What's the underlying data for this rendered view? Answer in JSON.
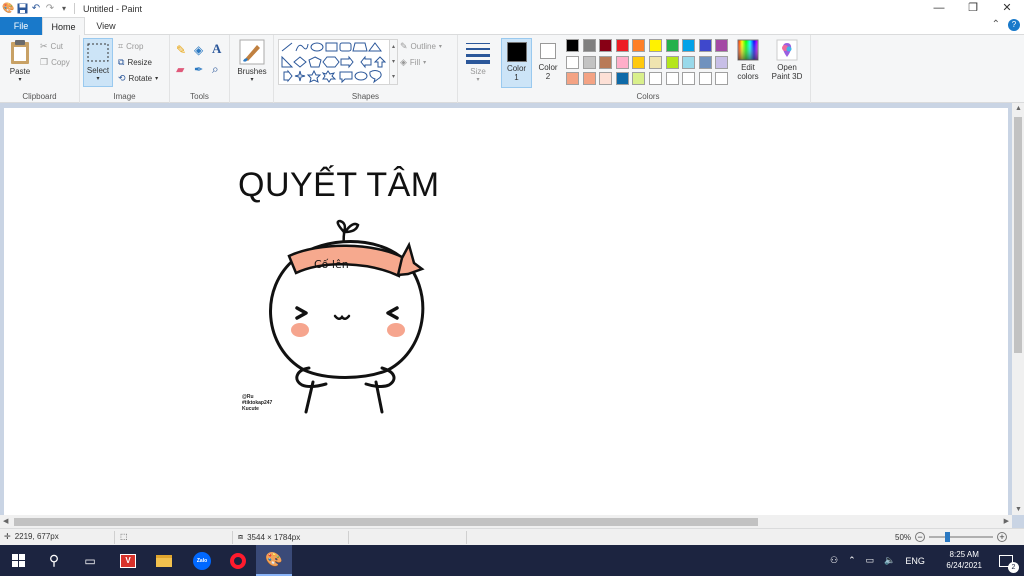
{
  "window": {
    "title": "Untitled - Paint"
  },
  "tabs": {
    "file": "File",
    "home": "Home",
    "view": "View"
  },
  "ribbon": {
    "clipboard": {
      "label": "Clipboard",
      "paste": "Paste",
      "cut": "Cut",
      "copy": "Copy"
    },
    "image": {
      "label": "Image",
      "select": "Select",
      "crop": "Crop",
      "resize": "Resize",
      "rotate": "Rotate"
    },
    "tools": {
      "label": "Tools"
    },
    "brushes": {
      "label": "Brushes"
    },
    "shapes": {
      "label": "Shapes",
      "outline": "Outline",
      "fill": "Fill"
    },
    "size": {
      "label": "Size"
    },
    "color1": {
      "line1": "Color",
      "line2": "1",
      "value": "#000000"
    },
    "color2": {
      "line1": "Color",
      "line2": "2",
      "value": "#ffffff"
    },
    "colors": {
      "label": "Colors",
      "palette": [
        "#000000",
        "#7f7f7f",
        "#880015",
        "#ed1c24",
        "#ff7f27",
        "#fff200",
        "#22b14c",
        "#00a2e8",
        "#3f48cc",
        "#a349a4",
        "#ffffff",
        "#c3c3c3",
        "#b97a57",
        "#ffaec9",
        "#ffc90e",
        "#efe4b0",
        "#b5e61d",
        "#99d9ea",
        "#7092be",
        "#c8bfe7",
        "#f4a384",
        "#f4a384",
        "#fde0d6",
        "#0e6aa8",
        "#d9ef8b",
        "#ffffff",
        "#ffffff",
        "#ffffff",
        "#ffffff",
        "#ffffff"
      ]
    },
    "edit_colors": {
      "line1": "Edit",
      "line2": "colors"
    },
    "paint3d": {
      "line1": "Open",
      "line2": "Paint 3D"
    }
  },
  "canvas": {
    "heading": "QUYẾT TÂM",
    "headband_text": "Cố lên",
    "signature_lines": [
      "@Ru",
      "#tiktokap247",
      "Kucute"
    ]
  },
  "statusbar": {
    "cursor_pos": "2219, 677px",
    "image_size": "3544 × 1784px",
    "zoom": "50%"
  },
  "taskbar": {
    "language": "ENG",
    "time": "8:25 AM",
    "date": "6/24/2021",
    "notifications": "2",
    "zalo_label": "Zalo"
  }
}
